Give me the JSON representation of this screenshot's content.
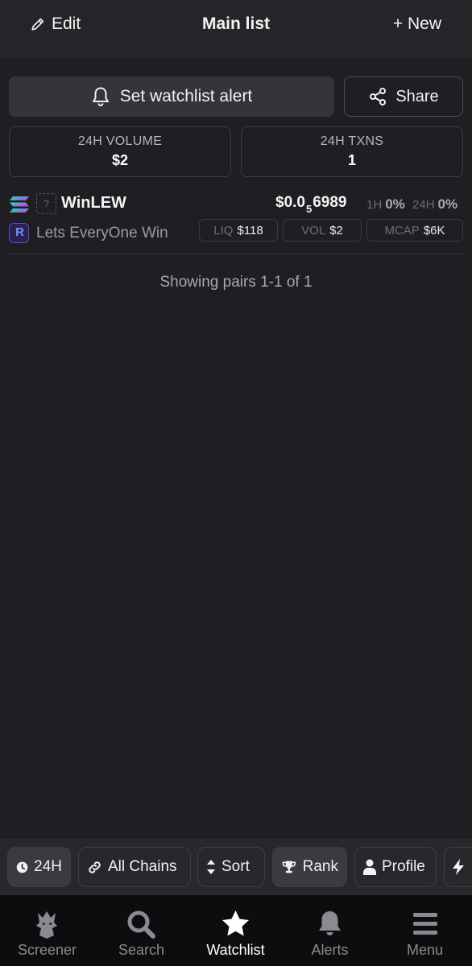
{
  "header": {
    "edit_label": "Edit",
    "title": "Main list",
    "new_label": "+ New"
  },
  "actions": {
    "alert_label": "Set watchlist alert",
    "share_label": "Share"
  },
  "stats": {
    "volume_label": "24H VOLUME",
    "volume_value": "$2",
    "txns_label": "24H TXNS",
    "txns_value": "1"
  },
  "pair": {
    "chain_icon": "solana-icon",
    "dex_icon": "raydium-icon",
    "unknown_token_icon": "?",
    "symbol": "WinLEW",
    "name": "Lets EveryOne Win",
    "price_prefix": "$0.0",
    "price_subscript": "5",
    "price_digits": "6989",
    "change_1h_label": "1H",
    "change_1h_value": "0%",
    "change_24h_label": "24H",
    "change_24h_value": "0%",
    "liq_label": "LIQ",
    "liq_value": "$118",
    "vol_label": "VOL",
    "vol_value": "$2",
    "mcap_label": "MCAP",
    "mcap_value": "$6K",
    "dex_letter": "R"
  },
  "showing_text": "Showing pairs 1-1 of 1",
  "filters": {
    "timeframe": "24H",
    "chains": "All Chains",
    "sort": "Sort",
    "rank": "Rank",
    "profile": "Profile"
  },
  "nav": {
    "items": [
      {
        "label": "Screener",
        "icon": "eagle-icon"
      },
      {
        "label": "Search",
        "icon": "search-icon"
      },
      {
        "label": "Watchlist",
        "icon": "star-icon",
        "active": true
      },
      {
        "label": "Alerts",
        "icon": "bell-icon"
      },
      {
        "label": "Menu",
        "icon": "menu-icon"
      }
    ]
  },
  "colors": {
    "background": "#1f1f23",
    "header": "#252529",
    "nav": "#0d0d0f",
    "muted": "#a8a8ad"
  }
}
